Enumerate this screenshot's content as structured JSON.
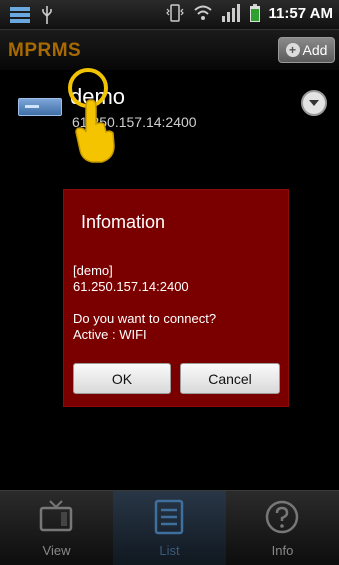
{
  "status_bar": {
    "time": "11:57 AM",
    "icons": [
      "menu-icon",
      "usb-icon",
      "vibrate-icon",
      "wifi-icon",
      "signal-icon",
      "battery-icon"
    ]
  },
  "app_bar": {
    "title": "MPRMS",
    "add_label": "Add"
  },
  "server_list": [
    {
      "name": "demo",
      "address": "61.250.157.14:2400"
    }
  ],
  "dialog": {
    "title": "Infomation",
    "server_line": "[demo]",
    "address_line": "61.250.157.14:2400",
    "question": "Do you want to connect?",
    "active_line": "Active : WIFI",
    "ok_label": "OK",
    "cancel_label": "Cancel"
  },
  "tabs": [
    {
      "label": "View",
      "icon": "tv-icon"
    },
    {
      "label": "List",
      "icon": "list-icon",
      "active": true
    },
    {
      "label": "Info",
      "icon": "info-icon"
    }
  ],
  "colors": {
    "title": "#a76a00",
    "dialog_background": "#7a0000",
    "active_tab": "#3a5a78",
    "cursor_highlight": "#f2c300"
  }
}
